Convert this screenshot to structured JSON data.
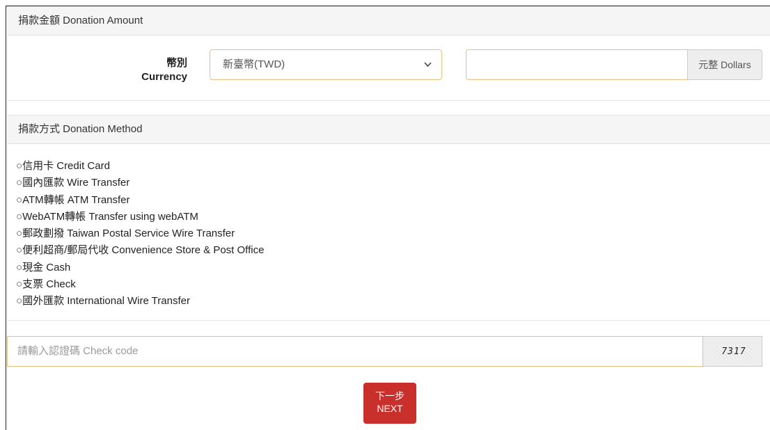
{
  "amount_section": {
    "heading": "捐款金額 Donation Amount",
    "currency_label_zh": "幣別",
    "currency_label_en": "Currency",
    "currency_selected": "新臺幣(TWD)",
    "amount_value": "",
    "amount_addon": "元整 Dollars"
  },
  "method_section": {
    "heading": "捐款方式 Donation Method",
    "radio_glyph": "○",
    "methods": [
      "信用卡 Credit Card",
      "國內匯款 Wire Transfer",
      "ATM轉帳 ATM Transfer",
      "WebATM轉帳 Transfer using webATM",
      "郵政劃撥 Taiwan Postal Service Wire Transfer",
      "便利超商/郵局代收 Convenience Store & Post Office",
      "現金 Cash",
      "支票 Check",
      "國外匯款 International Wire Transfer"
    ]
  },
  "check_code": {
    "placeholder": "請輸入認證碼 Check code",
    "captcha_text": "7317"
  },
  "next_button": {
    "label_zh": "下一步",
    "label_en": "NEXT",
    "color": "#c9302c"
  }
}
